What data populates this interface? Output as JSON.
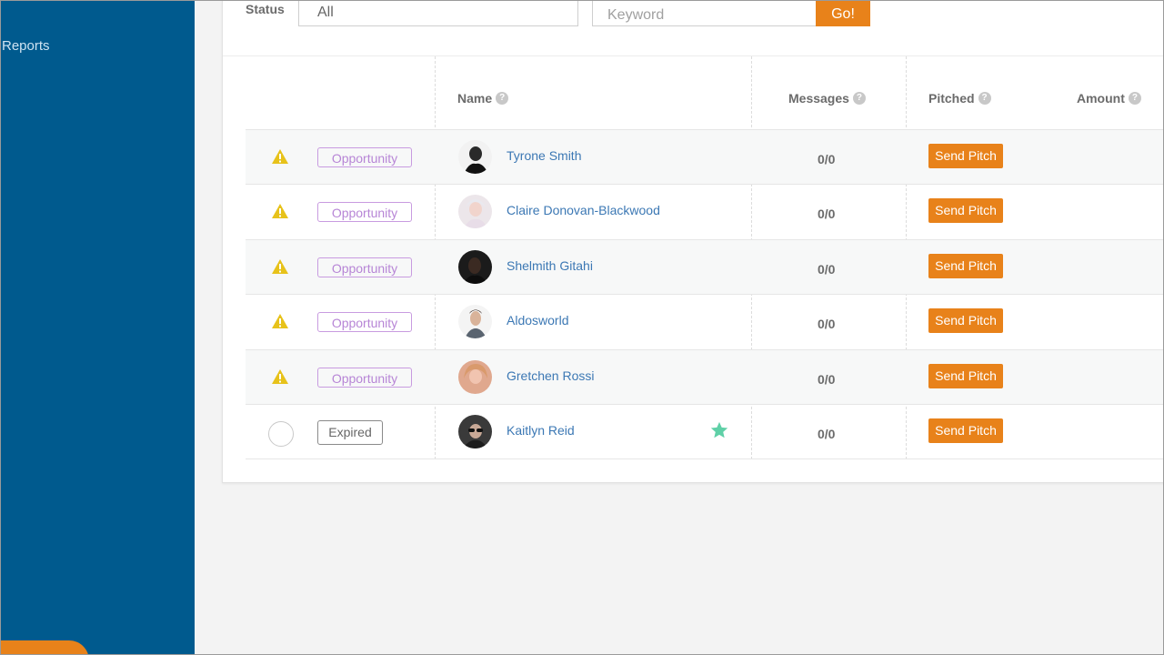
{
  "sidebar": {
    "reports_label": "Reports"
  },
  "filters": {
    "status_label": "Status",
    "status_value": "All",
    "keyword_placeholder": "Keyword",
    "go_label": "Go!"
  },
  "table": {
    "headers": {
      "name": "Name",
      "messages": "Messages",
      "pitched": "Pitched",
      "amount": "Amount"
    },
    "help_glyph": "?",
    "rows": [
      {
        "status_icon": "warning-icon",
        "tag": "Opportunity",
        "name": "Tyrone Smith",
        "messages": "0/0",
        "action": "Send Pitch",
        "starred": false
      },
      {
        "status_icon": "warning-icon",
        "tag": "Opportunity",
        "name": "Claire Donovan-Blackwood",
        "messages": "0/0",
        "action": "Send Pitch",
        "starred": false
      },
      {
        "status_icon": "warning-icon",
        "tag": "Opportunity",
        "name": "Shelmith Gitahi",
        "messages": "0/0",
        "action": "Send Pitch",
        "starred": false
      },
      {
        "status_icon": "warning-icon",
        "tag": "Opportunity",
        "name": "Aldosworld",
        "messages": "0/0",
        "action": "Send Pitch",
        "starred": false
      },
      {
        "status_icon": "warning-icon",
        "tag": "Opportunity",
        "name": "Gretchen Rossi",
        "messages": "0/0",
        "action": "Send Pitch",
        "starred": false
      },
      {
        "status_icon": "empty-circle",
        "tag": "Expired",
        "name": "Kaitlyn Reid",
        "messages": "0/0",
        "action": "Send Pitch",
        "starred": true
      }
    ]
  },
  "colors": {
    "sidebar": "#005a8e",
    "accent": "#e8821a",
    "link": "#3c78b4",
    "opportunity": "#b785d6",
    "warning": "#e7c21a",
    "star": "#5fd0a7"
  }
}
